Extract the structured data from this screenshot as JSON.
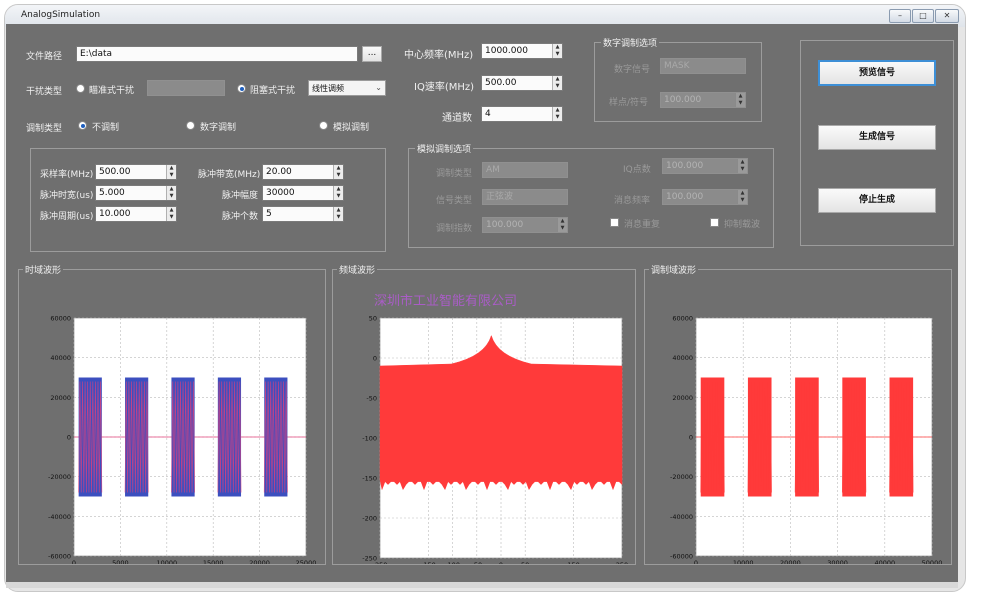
{
  "window": {
    "title": "AnalogSimulation",
    "controls": [
      "–",
      "□",
      "✕"
    ]
  },
  "file": {
    "label": "文件路径",
    "value": "E:\\data",
    "browse_label": "..."
  },
  "interference": {
    "label": "干扰类型",
    "option_pulse": "瞄准式干扰",
    "option_block": "阻塞式干扰",
    "mode_value": "线性调频"
  },
  "modulation": {
    "label": "调制类型",
    "option_none": "不调制",
    "option_digital": "数字调制",
    "option_analog": "模拟调制"
  },
  "params": {
    "sample_rate_label": "采样率(MHz)",
    "sample_rate_value": "500.00",
    "pulse_width_label": "脉冲时宽(us)",
    "pulse_width_value": "5.000",
    "pulse_period_label": "脉冲周期(us)",
    "pulse_period_value": "10.000",
    "pulse_bw_label": "脉冲带宽(MHz)",
    "pulse_bw_value": "20.00",
    "pulse_amp_label": "脉冲幅度",
    "pulse_amp_value": "30000",
    "pulse_count_label": "脉冲个数",
    "pulse_count_value": "5"
  },
  "center": {
    "center_freq_label": "中心频率(MHz)",
    "center_freq_value": "1000.000",
    "iq_rate_label": "IQ速率(MHz)",
    "iq_rate_value": "500.00",
    "channel_label": "通道数",
    "channel_value": "4"
  },
  "digital_opts": {
    "title": "数字调制选项",
    "signal_label": "数字信号",
    "signal_value": "MASK",
    "sps_label": "样点/符号",
    "sps_value": "100.000"
  },
  "analog_opts": {
    "title": "模拟调制选项",
    "mod_type_label": "调制类型",
    "mod_type_value": "AM",
    "sig_type_label": "信号类型",
    "sig_type_value": "正弦波",
    "index_label": "调制指数",
    "index_value": "100.000",
    "iq_points_label": "IQ点数",
    "iq_points_value": "100.000",
    "msg_freq_label": "消息频率",
    "msg_freq_value": "100.000",
    "msg_repeat_label": "消息重复",
    "suppress_label": "抑制载波"
  },
  "buttons": {
    "preview": "预览信号",
    "generate": "生成信号",
    "stop": "停止生成"
  },
  "panels": {
    "time_title": "时域波形",
    "freq_title": "频域波形",
    "mod_title": "调制域波形",
    "watermark": "深圳市工业智能有限公司"
  },
  "chart_data": [
    {
      "type": "line",
      "title": "时域波形",
      "x_ticks": [
        "0",
        "5000",
        "10000",
        "15000",
        "20000",
        "25000"
      ],
      "y_ticks": [
        "60000",
        "40000",
        "20000",
        "0",
        "-20000",
        "-40000",
        "-60000"
      ],
      "xlim": [
        0,
        25000
      ],
      "ylim": [
        -60000,
        60000
      ],
      "grid": true,
      "pulses": [
        {
          "start": 500,
          "end": 3000
        },
        {
          "start": 5500,
          "end": 8000
        },
        {
          "start": 10500,
          "end": 13000
        },
        {
          "start": 15500,
          "end": 18000
        },
        {
          "start": 20500,
          "end": 23000
        }
      ],
      "amplitude": 30000,
      "colors": {
        "primary": "#3c4fbf",
        "secondary": "#e0407a"
      }
    },
    {
      "type": "area",
      "title": "频域波形",
      "x_ticks": [
        "-250",
        "-150",
        "-100",
        "-50",
        "0",
        "50",
        "150",
        "250"
      ],
      "x_tick_values": [
        -250,
        -150,
        -100,
        -50,
        0,
        50,
        150,
        250
      ],
      "y_ticks": [
        "50",
        "0",
        "-50",
        "-100",
        "-150",
        "-200",
        "-250"
      ],
      "xlim": [
        -250,
        250
      ],
      "ylim": [
        -250,
        50
      ],
      "grid": true,
      "band_top": -10,
      "band_bottom": -152,
      "peak_x": -20,
      "peak_y": 28,
      "color": "#ff3a3a"
    },
    {
      "type": "line",
      "title": "调制域波形",
      "x_ticks": [
        "0",
        "10000",
        "20000",
        "30000",
        "40000",
        "50000"
      ],
      "y_ticks": [
        "60000",
        "40000",
        "20000",
        "0",
        "-20000",
        "-40000",
        "-60000"
      ],
      "xlim": [
        0,
        50000
      ],
      "ylim": [
        -60000,
        60000
      ],
      "grid": true,
      "pulses": [
        {
          "start": 1000,
          "end": 6000
        },
        {
          "start": 11000,
          "end": 16000
        },
        {
          "start": 21000,
          "end": 26000
        },
        {
          "start": 31000,
          "end": 36000
        },
        {
          "start": 41000,
          "end": 46000
        }
      ],
      "amplitude": 30000,
      "colors": {
        "primary": "#ff3a3a",
        "secondary": "#ff3a3a"
      }
    }
  ]
}
